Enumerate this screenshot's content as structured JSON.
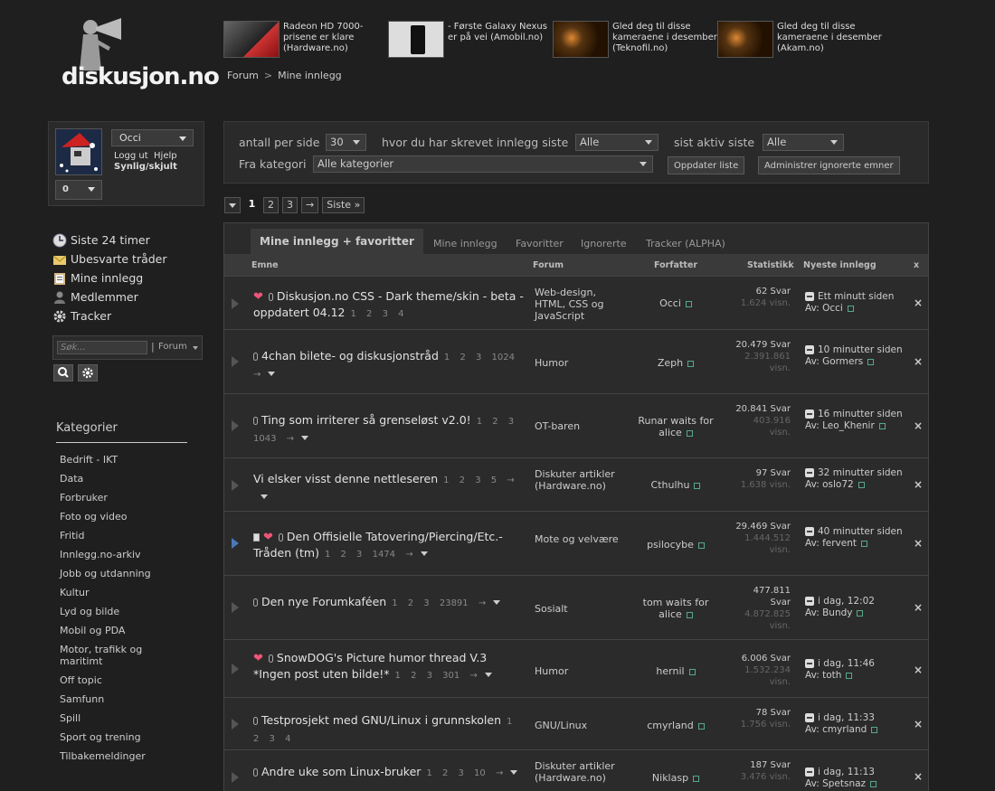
{
  "site": {
    "logo_text": "diskusjon.no"
  },
  "news": [
    {
      "caption": "Radeon HD 7000-prisene er klare (Hardware.no)"
    },
    {
      "caption": "- Første Galaxy Nexus er på vei (Amobil.no)"
    },
    {
      "caption": "Gled deg til disse kameraene i desember (Teknofil.no)"
    },
    {
      "caption": "Gled deg til disse kameraene i desember (Akam.no)"
    }
  ],
  "breadcrumb": {
    "root": "Forum",
    "sep": ">",
    "current": "Mine innlegg"
  },
  "user": {
    "name": "Occi",
    "logout": "Logg ut",
    "help": "Hjelp",
    "visibility": "Synlig/skjult",
    "count": "0"
  },
  "sidenav": [
    {
      "label": "Siste 24 timer",
      "icon": "clock-icon"
    },
    {
      "label": "Ubesvarte tråder",
      "icon": "envelope-icon"
    },
    {
      "label": "Mine innlegg",
      "icon": "clipboard-icon"
    },
    {
      "label": "Medlemmer",
      "icon": "user-icon"
    },
    {
      "label": "Tracker",
      "icon": "gear-icon"
    }
  ],
  "search": {
    "placeholder": "Søk...",
    "scope": "Forum"
  },
  "categories": {
    "heading": "Kategorier",
    "items": [
      "Bedrift - IKT",
      "Data",
      "Forbruker",
      "Foto og video",
      "Fritid",
      "Innlegg.no-arkiv",
      "Jobb og utdanning",
      "Kultur",
      "Lyd og bilde",
      "Mobil og PDA",
      "Motor, trafikk og maritimt",
      "Off topic",
      "Samfunn",
      "Spill",
      "Sport og trening",
      "Tilbakemeldinger"
    ]
  },
  "filters": {
    "per_page_label": "antall per side",
    "per_page_value": "30",
    "where_label": "hvor du har skrevet innlegg siste",
    "where_value": "Alle",
    "active_label": "sist aktiv siste",
    "active_value": "Alle",
    "category_label": "Fra kategori",
    "category_value": "Alle kategorier",
    "update_button": "Oppdater liste",
    "manage_button": "Administrer ignorerte emner"
  },
  "pager": {
    "pages": [
      "1",
      "2",
      "3"
    ],
    "next": "→",
    "last": "Siste »"
  },
  "tabs": [
    "Mine innlegg + favoritter",
    "Mine innlegg",
    "Favoritter",
    "Ignorerte",
    "Tracker (ALPHA)"
  ],
  "columns": {
    "topic": "Emne",
    "forum": "Forum",
    "author": "Forfatter",
    "stats": "Statistikk",
    "latest": "Nyeste innlegg",
    "close": "x"
  },
  "rows": [
    {
      "title": "Diskusjon.no CSS - Dark theme/skin - beta - oppdatert 04.12",
      "pages": "1 2 3 4",
      "forum": "Web-design, HTML, CSS og JavaScript",
      "author": "Occi",
      "replies": "62 Svar",
      "views": "1.624 visn.",
      "latest_time": "Ett minutt siden",
      "latest_by": "Av: Occi"
    },
    {
      "title": "4chan bilete- og diskusjonstråd",
      "pages": "1 2 3 1024 →",
      "forum": "Humor",
      "author": "Zeph",
      "replies": "20.479 Svar",
      "views": "2.391.861 visn.",
      "latest_time": "10 minutter siden",
      "latest_by": "Av: Gormers"
    },
    {
      "title": "Ting som irriterer så grenseløst v2.0!",
      "pages": "1 2 3 1043 →",
      "forum": "OT-baren",
      "author": "Runar waits for alice",
      "replies": "20.841 Svar",
      "views": "403.916 visn.",
      "latest_time": "16 minutter siden",
      "latest_by": "Av: Leo_Khenir"
    },
    {
      "title": "Vi elsker visst denne nettleseren",
      "pages": "1 2 3 5 →",
      "forum": "Diskuter artikler (Hardware.no)",
      "author": "Cthulhu",
      "replies": "97 Svar",
      "views": "1.638 visn.",
      "latest_time": "32 minutter siden",
      "latest_by": "Av: oslo72"
    },
    {
      "title": "Den Offisielle Tatovering/Piercing/Etc.-Tråden (tm)",
      "pages": "1 2 3 1474 →",
      "forum": "Mote og velvære",
      "author": "psilocybe",
      "replies": "29.469 Svar",
      "views": "1.444.512 visn.",
      "latest_time": "40 minutter siden",
      "latest_by": "Av: fervent"
    },
    {
      "title": "Den nye Forumkaféen",
      "pages": "1 2 3 23891 →",
      "forum": "Sosialt",
      "author": "tom waits for alice",
      "replies": "477.811 Svar",
      "views": "4.872.825 visn.",
      "latest_time": "i dag, 12:02",
      "latest_by": "Av: Bundy"
    },
    {
      "title": "SnowDOG's Picture humor thread V.3 *Ingen post uten bilde!*",
      "pages": "1 2 3 301 →",
      "forum": "Humor",
      "author": "hernil",
      "replies": "6.006 Svar",
      "views": "1.532.234 visn.",
      "latest_time": "i dag, 11:46",
      "latest_by": "Av: toth"
    },
    {
      "title": "Testprosjekt med GNU/Linux i grunnskolen",
      "pages": "1 2 3 4",
      "forum": "GNU/Linux",
      "author": "cmyrland",
      "replies": "78 Svar",
      "views": "1.756 visn.",
      "latest_time": "i dag, 11:33",
      "latest_by": "Av: cmyrland"
    },
    {
      "title": "Andre uke som Linux-bruker",
      "pages": "1 2 3 10 →",
      "forum": "Diskuter artikler (Hardware.no)",
      "author": "Niklasp",
      "replies": "187 Svar",
      "views": "3.476 visn.",
      "latest_time": "i dag, 11:13",
      "latest_by": "Av: Spetsnaz"
    }
  ]
}
